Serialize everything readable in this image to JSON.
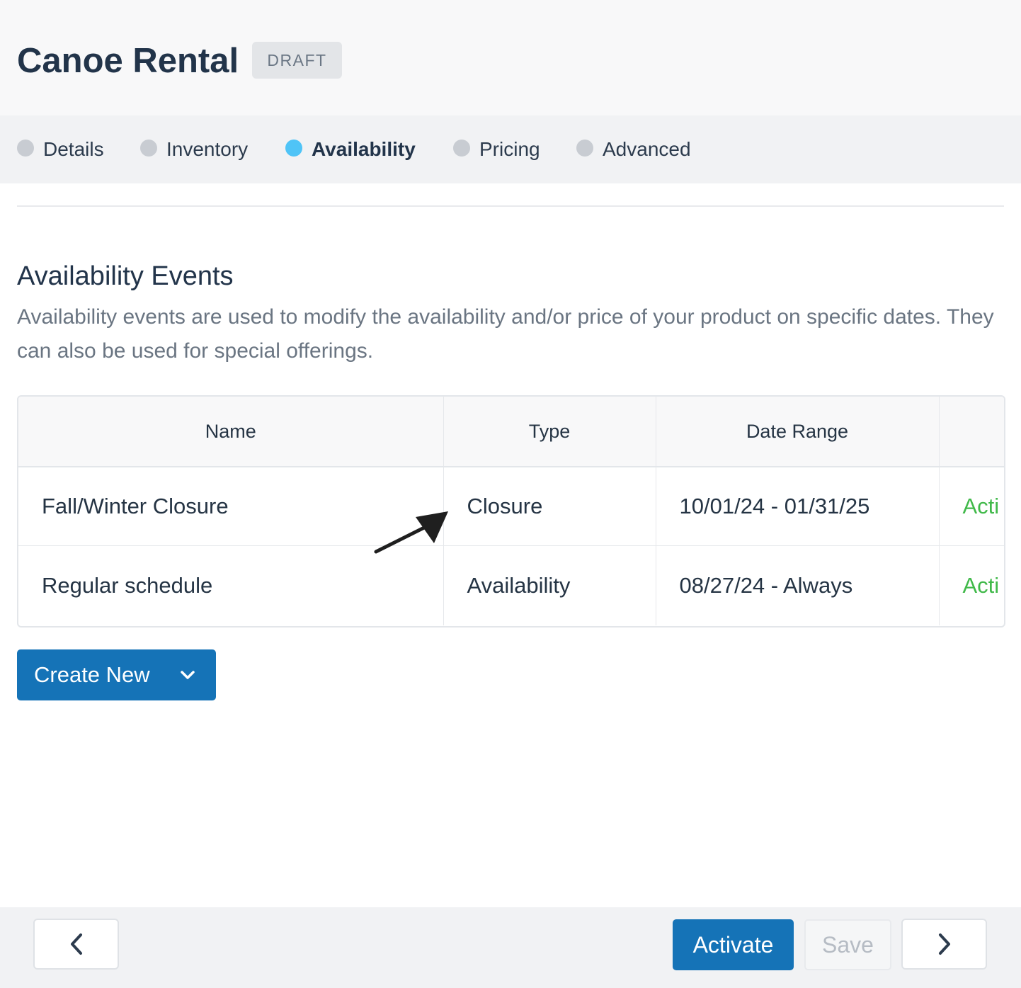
{
  "header": {
    "title": "Canoe Rental",
    "badge": "DRAFT"
  },
  "steps": [
    {
      "label": "Details",
      "active": false
    },
    {
      "label": "Inventory",
      "active": false
    },
    {
      "label": "Availability",
      "active": true
    },
    {
      "label": "Pricing",
      "active": false
    },
    {
      "label": "Advanced",
      "active": false
    }
  ],
  "section": {
    "title": "Availability Events",
    "description": "Availability events are used to modify the availability and/or price of your product on specific dates. They can also be used for special offerings."
  },
  "table": {
    "columns": [
      "Name",
      "Type",
      "Date Range",
      ""
    ],
    "rows": [
      {
        "name": "Fall/Winter Closure",
        "type": "Closure",
        "date_range": "10/01/24 - 01/31/25",
        "status": "Acti"
      },
      {
        "name": "Regular schedule",
        "type": "Availability",
        "date_range": "08/27/24 - Always",
        "status": "Acti"
      }
    ]
  },
  "actions": {
    "create_new": "Create New"
  },
  "footer": {
    "activate": "Activate",
    "save": "Save"
  },
  "colors": {
    "primary": "#1573b7",
    "active_step": "#4fc4f7",
    "inactive_step": "#c8ccd2",
    "status_green": "#41b94a",
    "title_text": "#22344a"
  },
  "icons": {
    "create_new": "chevron-down-icon",
    "prev": "chevron-left-icon",
    "next": "chevron-right-icon",
    "annotation": "arrow-icon"
  }
}
